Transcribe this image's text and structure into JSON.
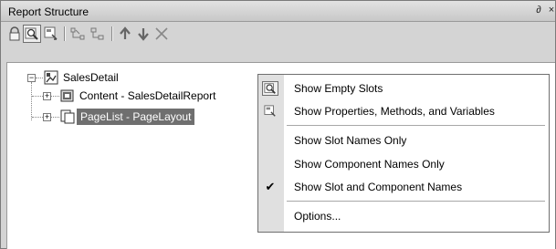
{
  "window": {
    "title": "Report Structure",
    "pin_glyph": "∂",
    "close_glyph": "×"
  },
  "toolbar": {
    "icons": [
      "lock-icon",
      "find-icon",
      "properties-icon",
      "link-icon",
      "group-icon",
      "arrow-up-icon",
      "arrow-down-icon",
      "delete-icon"
    ]
  },
  "tree": {
    "root": {
      "label": "SalesDetail"
    },
    "children": [
      {
        "label": "Content - SalesDetailReport"
      },
      {
        "label": "PageList - PageLayout"
      }
    ]
  },
  "menu": {
    "items": [
      {
        "label": "Show Empty Slots",
        "icon": "find-icon"
      },
      {
        "label": "Show Properties, Methods, and Variables",
        "icon": "properties-icon"
      },
      {
        "label": "Show Slot Names Only"
      },
      {
        "label": "Show Component Names Only"
      },
      {
        "label": "Show Slot and Component Names",
        "checked": true,
        "check_glyph": "✔"
      },
      {
        "label": "Options..."
      }
    ]
  },
  "colors": {
    "selection": "#6f6f6f",
    "gutter": "#e0e0e0",
    "panel": "#d4d4d4"
  }
}
